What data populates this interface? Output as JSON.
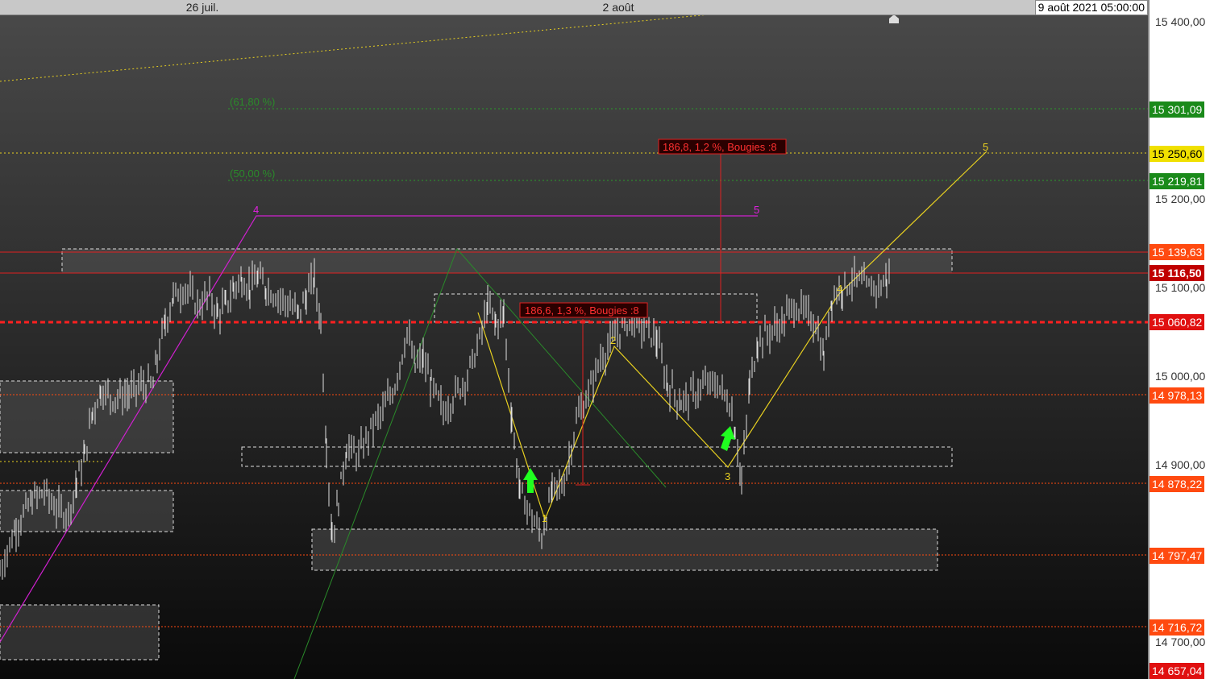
{
  "header": {
    "date_labels": [
      {
        "text": "26 juil."
      },
      {
        "text": "2 août"
      }
    ],
    "crosshair_date": "9 août 2021 05:00:00"
  },
  "colors": {
    "background_top": "#4a4a4a",
    "background_bottom": "#0a0a0a",
    "candle": "#e0e0e0",
    "fib_green": "#2a8a2a",
    "yellow": "#e8d020",
    "magenta": "#d020d0",
    "red": "#e01010",
    "orange_tag": "#ff4a10",
    "axis_bg": "#ffffff"
  },
  "chart_data": {
    "type": "line",
    "ylim": [
      14640,
      15440
    ],
    "y_axis_ticks": [
      "15 400,00",
      "15 200,00",
      "15 100,00",
      "15 000,00",
      "14 900,00",
      "14 700,00"
    ],
    "price_tags": [
      {
        "text": "15 301,09",
        "value": 15301.09,
        "bg": "#1a8a1a",
        "fg": "#ffffff"
      },
      {
        "text": "15 250,60",
        "value": 15250.6,
        "bg": "#f0e000",
        "fg": "#000000"
      },
      {
        "text": "15 219,81",
        "value": 15219.81,
        "bg": "#1a8a1a",
        "fg": "#ffffff"
      },
      {
        "text": "15 139,63",
        "value": 15139.63,
        "bg": "#ff4a10",
        "fg": "#ffffff"
      },
      {
        "text": "15 116,50",
        "value": 15116.5,
        "bg": "#c00000",
        "fg": "#ffffff"
      },
      {
        "text": "15 060,82",
        "value": 15060.82,
        "bg": "#e01010",
        "fg": "#ffffff"
      },
      {
        "text": "14 978,13",
        "value": 14978.13,
        "bg": "#ff4a10",
        "fg": "#ffffff"
      },
      {
        "text": "14 878,22",
        "value": 14878.22,
        "bg": "#ff4a10",
        "fg": "#ffffff"
      },
      {
        "text": "14 797,47",
        "value": 14797.47,
        "bg": "#ff4a10",
        "fg": "#ffffff"
      },
      {
        "text": "14 716,72",
        "value": 14716.72,
        "bg": "#ff4a10",
        "fg": "#ffffff"
      },
      {
        "text": "14 657,04",
        "value": 14657.04,
        "bg": "#e01010",
        "fg": "#ffffff"
      }
    ],
    "fib_labels": [
      "(61,80 %)",
      "(50,00 %)"
    ],
    "measure_labels": [
      "186,8, 1,2 %, Bougies :8",
      "186,6, 1,3 %, Bougies :8"
    ],
    "wave_labels_yellow": [
      "2",
      "3",
      "4",
      "5",
      "1"
    ],
    "wave_labels_magenta": [
      "4",
      "5"
    ],
    "price_path": [
      [
        0,
        14780
      ],
      [
        20,
        14830
      ],
      [
        40,
        14860
      ],
      [
        55,
        14870
      ],
      [
        70,
        14850
      ],
      [
        85,
        14845
      ],
      [
        95,
        14880
      ],
      [
        105,
        14910
      ],
      [
        115,
        14960
      ],
      [
        125,
        14985
      ],
      [
        140,
        14975
      ],
      [
        160,
        14980
      ],
      [
        175,
        14990
      ],
      [
        190,
        14990
      ],
      [
        195,
        15020
      ],
      [
        205,
        15060
      ],
      [
        215,
        15090
      ],
      [
        230,
        15100
      ],
      [
        245,
        15080
      ],
      [
        260,
        15090
      ],
      [
        270,
        15070
      ],
      [
        280,
        15080
      ],
      [
        290,
        15100
      ],
      [
        300,
        15110
      ],
      [
        310,
        15100
      ],
      [
        320,
        15110
      ],
      [
        330,
        15100
      ],
      [
        345,
        15090
      ],
      [
        360,
        15080
      ],
      [
        370,
        15070
      ],
      [
        380,
        15090
      ],
      [
        390,
        15110
      ],
      [
        398,
        15060
      ],
      [
        405,
        14920
      ],
      [
        412,
        14820
      ],
      [
        420,
        14860
      ],
      [
        430,
        14920
      ],
      [
        445,
        14910
      ],
      [
        460,
        14940
      ],
      [
        475,
        14960
      ],
      [
        490,
        14990
      ],
      [
        505,
        15050
      ],
      [
        515,
        15010
      ],
      [
        525,
        15020
      ],
      [
        535,
        14990
      ],
      [
        550,
        14960
      ],
      [
        565,
        14980
      ],
      [
        580,
        15000
      ],
      [
        595,
        15040
      ],
      [
        605,
        15080
      ],
      [
        615,
        15060
      ],
      [
        625,
        15070
      ],
      [
        635,
        14950
      ],
      [
        645,
        14870
      ],
      [
        660,
        14840
      ],
      [
        672,
        14820
      ],
      [
        685,
        14870
      ],
      [
        700,
        14880
      ],
      [
        715,
        14950
      ],
      [
        730,
        14980
      ],
      [
        745,
        15020
      ],
      [
        760,
        15040
      ],
      [
        775,
        15060
      ],
      [
        790,
        15060
      ],
      [
        805,
        15050
      ],
      [
        815,
        15040
      ],
      [
        828,
        14990
      ],
      [
        845,
        14970
      ],
      [
        860,
        14980
      ],
      [
        875,
        14990
      ],
      [
        890,
        14990
      ],
      [
        905,
        14970
      ],
      [
        912,
        14940
      ],
      [
        920,
        14880
      ],
      [
        930,
        14990
      ],
      [
        940,
        15040
      ],
      [
        955,
        15050
      ],
      [
        970,
        15060
      ],
      [
        985,
        15080
      ],
      [
        1000,
        15070
      ],
      [
        1012,
        15060
      ],
      [
        1022,
        15020
      ],
      [
        1032,
        15090
      ],
      [
        1045,
        15100
      ],
      [
        1060,
        15110
      ],
      [
        1075,
        15100
      ],
      [
        1090,
        15100
      ],
      [
        1100,
        15110
      ],
      [
        1106,
        15120
      ]
    ]
  }
}
